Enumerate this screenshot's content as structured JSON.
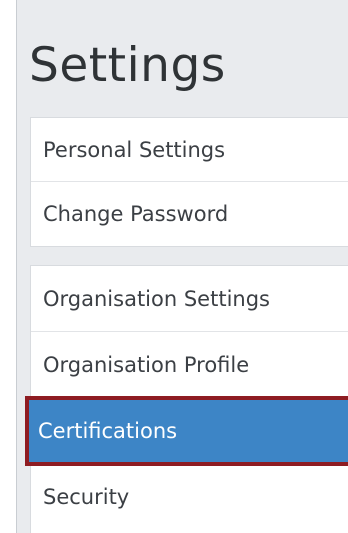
{
  "page": {
    "title": "Settings"
  },
  "menu": {
    "group_personal": [
      {
        "label": "Personal Settings",
        "active": false
      },
      {
        "label": "Change Password",
        "active": false
      }
    ],
    "group_organisation": [
      {
        "label": "Organisation Settings",
        "active": false
      },
      {
        "label": "Organisation Profile",
        "active": false
      },
      {
        "label": "Certifications",
        "active": true
      },
      {
        "label": "Security",
        "active": false
      }
    ]
  },
  "colors": {
    "active_background": "#3d85c6",
    "active_outline": "#8e1c22",
    "sidebar_background": "#e9ebee"
  }
}
